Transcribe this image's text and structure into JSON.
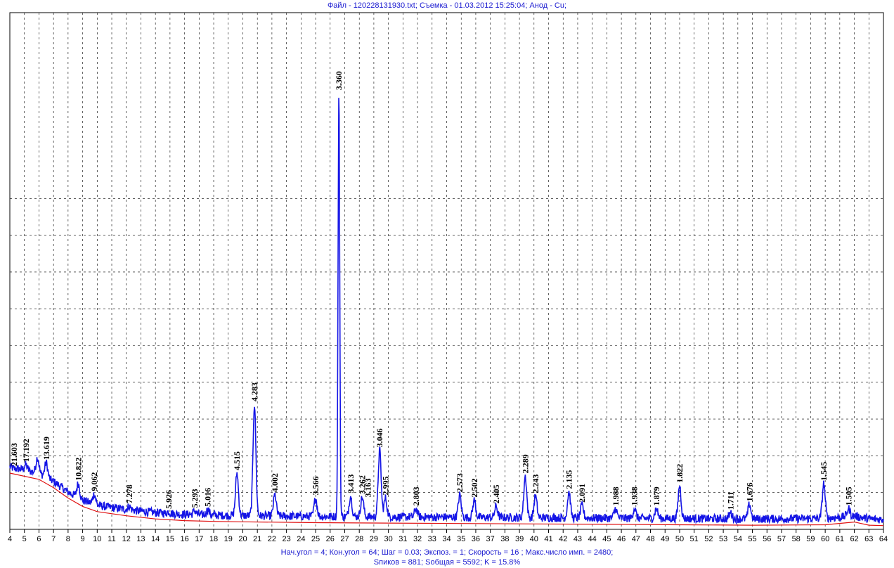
{
  "header": {
    "title": "Файл - 120228131930.txt;  Съемка - 01.03.2012 15:25:04;  Анод - Cu;"
  },
  "footer": {
    "line1": "Нач.угол = 4;  Кон.угол = 64;  Шаг = 0.03;  Экспоз. = 1;  Скорость = 16 ;  Макс.число имп. = 2480;",
    "line2": "Sпиков =   881;  Sобщая =   5592;  K =  15.8%"
  },
  "chart_data": {
    "type": "line",
    "xlim": [
      4,
      64
    ],
    "ylim": [
      0,
      2480
    ],
    "x_ticks": [
      4,
      5,
      6,
      7,
      8,
      9,
      10,
      11,
      12,
      13,
      14,
      15,
      16,
      17,
      18,
      19,
      20,
      21,
      22,
      23,
      24,
      25,
      26,
      27,
      28,
      29,
      30,
      31,
      32,
      33,
      34,
      35,
      36,
      37,
      38,
      39,
      40,
      41,
      42,
      43,
      44,
      45,
      46,
      47,
      48,
      49,
      50,
      51,
      52,
      53,
      54,
      55,
      56,
      57,
      58,
      59,
      60,
      61,
      62,
      63,
      64
    ],
    "grid": true,
    "colors": {
      "pattern": "#1414e6",
      "background": "#e01010",
      "labels": "#000000",
      "text": "#1a1ad0"
    },
    "series": [
      {
        "role": "pattern",
        "peaks": [
          {
            "x": 4.3,
            "y": 290
          },
          {
            "x": 5.1,
            "y": 310
          },
          {
            "x": 5.9,
            "y": 345
          },
          {
            "x": 6.5,
            "y": 320
          },
          {
            "x": 8.7,
            "y": 220
          },
          {
            "x": 9.8,
            "y": 170
          },
          {
            "x": 12.2,
            "y": 110
          },
          {
            "x": 14.9,
            "y": 85
          },
          {
            "x": 16.7,
            "y": 90
          },
          {
            "x": 17.6,
            "y": 95
          },
          {
            "x": 19.6,
            "y": 270
          },
          {
            "x": 20.8,
            "y": 600
          },
          {
            "x": 22.2,
            "y": 165
          },
          {
            "x": 25.0,
            "y": 150
          },
          {
            "x": 26.6,
            "y": 2095
          },
          {
            "x": 27.4,
            "y": 160
          },
          {
            "x": 28.2,
            "y": 155
          },
          {
            "x": 29.4,
            "y": 380
          },
          {
            "x": 29.8,
            "y": 150
          },
          {
            "x": 31.9,
            "y": 100
          },
          {
            "x": 34.9,
            "y": 165
          },
          {
            "x": 35.9,
            "y": 140
          },
          {
            "x": 37.4,
            "y": 110
          },
          {
            "x": 39.4,
            "y": 255
          },
          {
            "x": 40.1,
            "y": 160
          },
          {
            "x": 42.4,
            "y": 180
          },
          {
            "x": 43.3,
            "y": 115
          },
          {
            "x": 45.6,
            "y": 100
          },
          {
            "x": 46.9,
            "y": 100
          },
          {
            "x": 48.4,
            "y": 100
          },
          {
            "x": 50.0,
            "y": 210
          },
          {
            "x": 53.5,
            "y": 80
          },
          {
            "x": 54.8,
            "y": 120
          },
          {
            "x": 59.9,
            "y": 220
          },
          {
            "x": 61.6,
            "y": 100
          }
        ]
      },
      {
        "role": "background",
        "points": [
          [
            4,
            270
          ],
          [
            6,
            240
          ],
          [
            7,
            200
          ],
          [
            8,
            150
          ],
          [
            9,
            110
          ],
          [
            10,
            85
          ],
          [
            12,
            65
          ],
          [
            14,
            50
          ],
          [
            16,
            42
          ],
          [
            18,
            38
          ],
          [
            20,
            36
          ],
          [
            25,
            32
          ],
          [
            30,
            30
          ],
          [
            35,
            28
          ],
          [
            40,
            26
          ],
          [
            45,
            24
          ],
          [
            50,
            22
          ],
          [
            55,
            20
          ],
          [
            60,
            22
          ],
          [
            62,
            35
          ],
          [
            63,
            20
          ],
          [
            64,
            18
          ]
        ]
      }
    ],
    "annotations": [
      {
        "x": 4.3,
        "y": 290,
        "text": "21.603"
      },
      {
        "x": 5.1,
        "y": 310,
        "text": "17.192"
      },
      {
        "x": 6.5,
        "y": 320,
        "text": "13.619"
      },
      {
        "x": 8.7,
        "y": 220,
        "text": "10.822"
      },
      {
        "x": 9.8,
        "y": 170,
        "text": "9.062"
      },
      {
        "x": 12.2,
        "y": 110,
        "text": "7.278"
      },
      {
        "x": 14.9,
        "y": 85,
        "text": "5.926"
      },
      {
        "x": 16.7,
        "y": 90,
        "text": "5.293"
      },
      {
        "x": 17.6,
        "y": 95,
        "text": "5.016"
      },
      {
        "x": 19.6,
        "y": 270,
        "text": "4.515"
      },
      {
        "x": 20.8,
        "y": 600,
        "text": "4.283"
      },
      {
        "x": 22.2,
        "y": 165,
        "text": "4.002"
      },
      {
        "x": 25.0,
        "y": 150,
        "text": "3.566"
      },
      {
        "x": 26.6,
        "y": 2095,
        "text": "3.360"
      },
      {
        "x": 27.4,
        "y": 160,
        "text": "3.413"
      },
      {
        "x": 28.2,
        "y": 155,
        "text": "3.262"
      },
      {
        "x": 28.6,
        "y": 140,
        "text": "3.163"
      },
      {
        "x": 29.4,
        "y": 380,
        "text": "3.046"
      },
      {
        "x": 29.8,
        "y": 150,
        "text": "2.995"
      },
      {
        "x": 31.9,
        "y": 100,
        "text": "2.803"
      },
      {
        "x": 34.9,
        "y": 165,
        "text": "2.573"
      },
      {
        "x": 35.9,
        "y": 140,
        "text": "2.502"
      },
      {
        "x": 37.4,
        "y": 110,
        "text": "2.405"
      },
      {
        "x": 39.4,
        "y": 255,
        "text": "2.289"
      },
      {
        "x": 40.1,
        "y": 160,
        "text": "2.243"
      },
      {
        "x": 42.4,
        "y": 180,
        "text": "2.135"
      },
      {
        "x": 43.3,
        "y": 115,
        "text": "2.091"
      },
      {
        "x": 45.6,
        "y": 100,
        "text": "1.988"
      },
      {
        "x": 46.9,
        "y": 100,
        "text": "1.938"
      },
      {
        "x": 48.4,
        "y": 100,
        "text": "1.879"
      },
      {
        "x": 50.0,
        "y": 210,
        "text": "1.822"
      },
      {
        "x": 53.5,
        "y": 80,
        "text": "1.711"
      },
      {
        "x": 54.8,
        "y": 120,
        "text": "1.676"
      },
      {
        "x": 59.9,
        "y": 220,
        "text": "1.545"
      },
      {
        "x": 61.6,
        "y": 100,
        "text": "1.505"
      }
    ]
  }
}
